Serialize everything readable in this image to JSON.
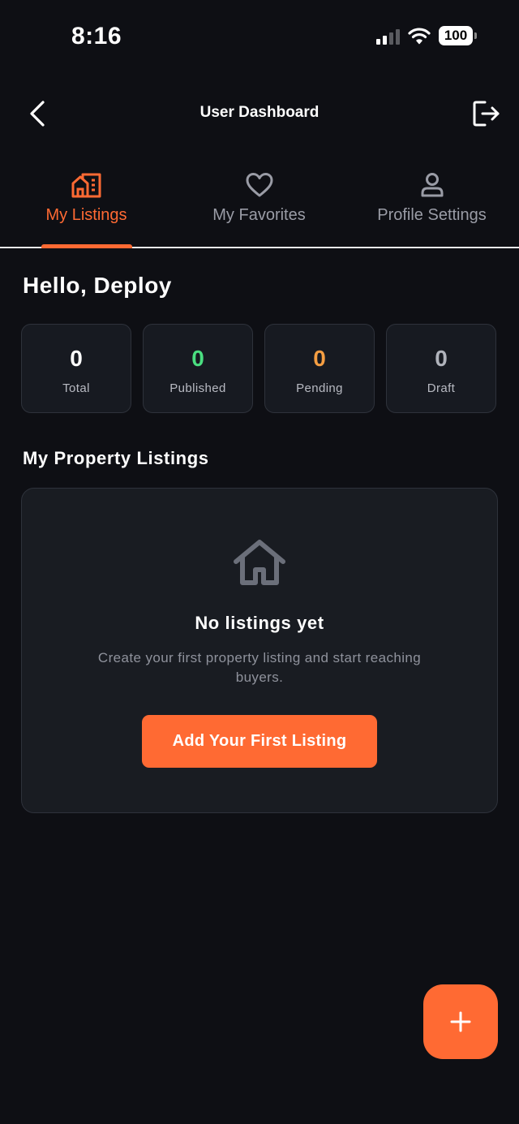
{
  "status_bar": {
    "time": "8:16",
    "battery": "100"
  },
  "header": {
    "title": "User Dashboard",
    "back_icon": "chevron-left-icon",
    "logout_icon": "logout-icon"
  },
  "tabs": [
    {
      "label": "My Listings",
      "icon": "building-icon",
      "active": true
    },
    {
      "label": "My Favorites",
      "icon": "heart-icon",
      "active": false
    },
    {
      "label": "Profile Settings",
      "icon": "user-icon",
      "active": false
    }
  ],
  "greeting": "Hello, Deploy",
  "stats": [
    {
      "value": "0",
      "label": "Total",
      "color": "#ffffff"
    },
    {
      "value": "0",
      "label": "Published",
      "color": "#4ade80"
    },
    {
      "value": "0",
      "label": "Pending",
      "color": "#f59e42"
    },
    {
      "value": "0",
      "label": "Draft",
      "color": "#b0b3bb"
    }
  ],
  "listings": {
    "section_title": "My Property Listings",
    "empty": {
      "icon": "house-icon",
      "title": "No listings yet",
      "text": "Create your first property listing and start reaching buyers.",
      "button_label": "Add Your First Listing"
    }
  },
  "fab": {
    "icon": "plus-icon"
  },
  "colors": {
    "accent": "#ff6a33",
    "background": "#0e0f14",
    "card": "#191c22"
  }
}
